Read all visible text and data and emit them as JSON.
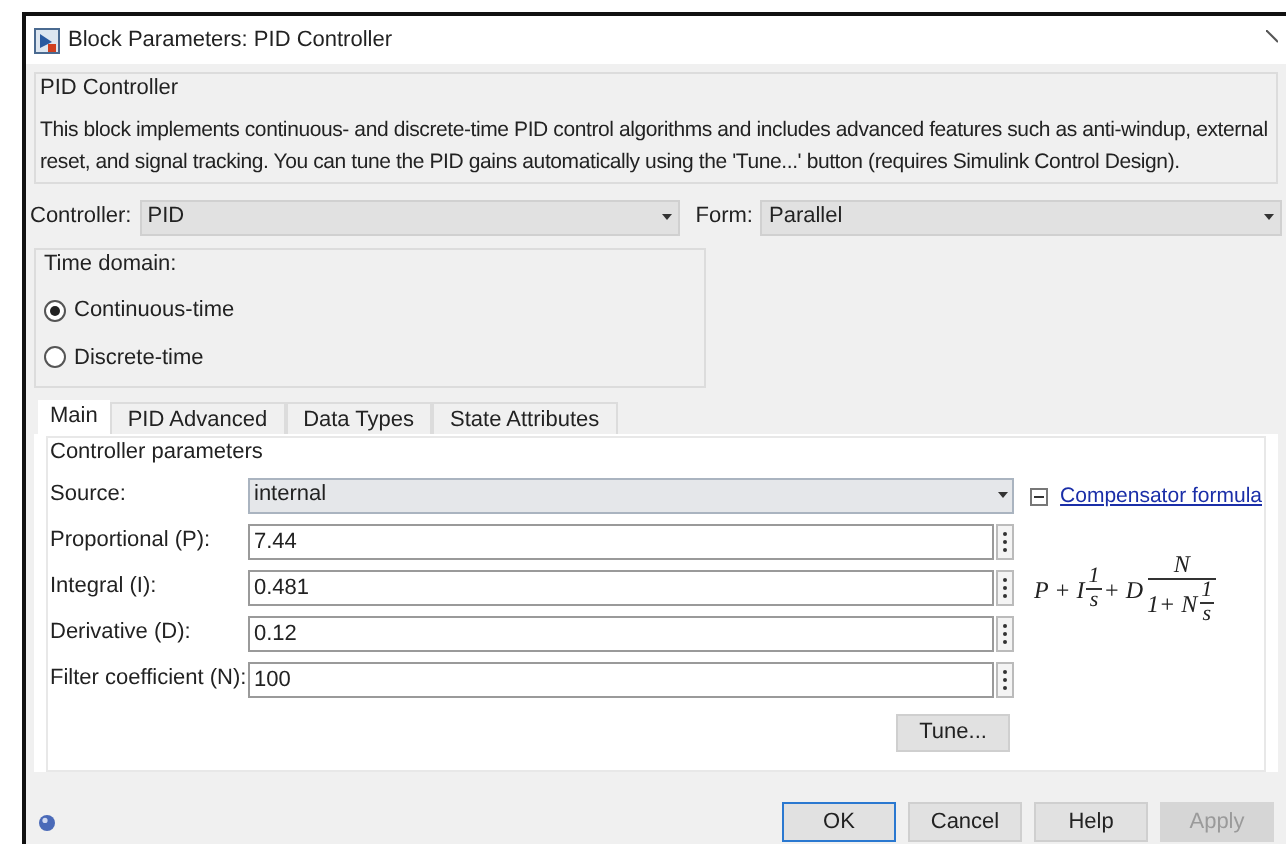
{
  "window": {
    "title": "Block Parameters: PID Controller"
  },
  "block": {
    "title": "PID Controller",
    "description": "This block implements continuous- and discrete-time PID control algorithms and includes advanced features such as anti-windup, external reset, and signal tracking. You can tune the PID gains automatically using the 'Tune...' button (requires Simulink Control Design)."
  },
  "controller": {
    "label": "Controller:",
    "value": "PID"
  },
  "form": {
    "label": "Form:",
    "value": "Parallel"
  },
  "time_domain": {
    "title": "Time domain:",
    "options": [
      {
        "label": "Continuous-time",
        "selected": true
      },
      {
        "label": "Discrete-time",
        "selected": false
      }
    ]
  },
  "tabs": [
    {
      "label": "Main",
      "selected": true
    },
    {
      "label": "PID Advanced",
      "selected": false
    },
    {
      "label": "Data Types",
      "selected": false
    },
    {
      "label": "State Attributes",
      "selected": false
    }
  ],
  "parameters": {
    "title": "Controller parameters",
    "rows": [
      {
        "kind": "dropdown",
        "label": "Source:",
        "value": "internal"
      },
      {
        "kind": "field",
        "label": "Proportional (P):",
        "value": "7.44"
      },
      {
        "kind": "field",
        "label": "Integral (I):",
        "value": "0.481"
      },
      {
        "kind": "field",
        "label": "Derivative (D):",
        "value": "0.12"
      },
      {
        "kind": "field",
        "label": "Filter coefficient (N):",
        "value": "100"
      }
    ],
    "tune_button": "Tune...",
    "formula_toggle": {
      "expanded": true
    },
    "formula_link": "Compensator formula",
    "formula": {
      "lead": "P + I",
      "frac1": {
        "num": "1",
        "den": "s"
      },
      "mid": "+ D",
      "frac2": {
        "num": "N",
        "den_lead": "1+ N",
        "den_frac": {
          "num": "1",
          "den": "s"
        }
      }
    }
  },
  "buttons": [
    {
      "label": "OK",
      "default": true,
      "disabled": false
    },
    {
      "label": "Cancel",
      "default": false,
      "disabled": false
    },
    {
      "label": "Help",
      "default": false,
      "disabled": false
    },
    {
      "label": "Apply",
      "default": false,
      "disabled": true
    }
  ]
}
